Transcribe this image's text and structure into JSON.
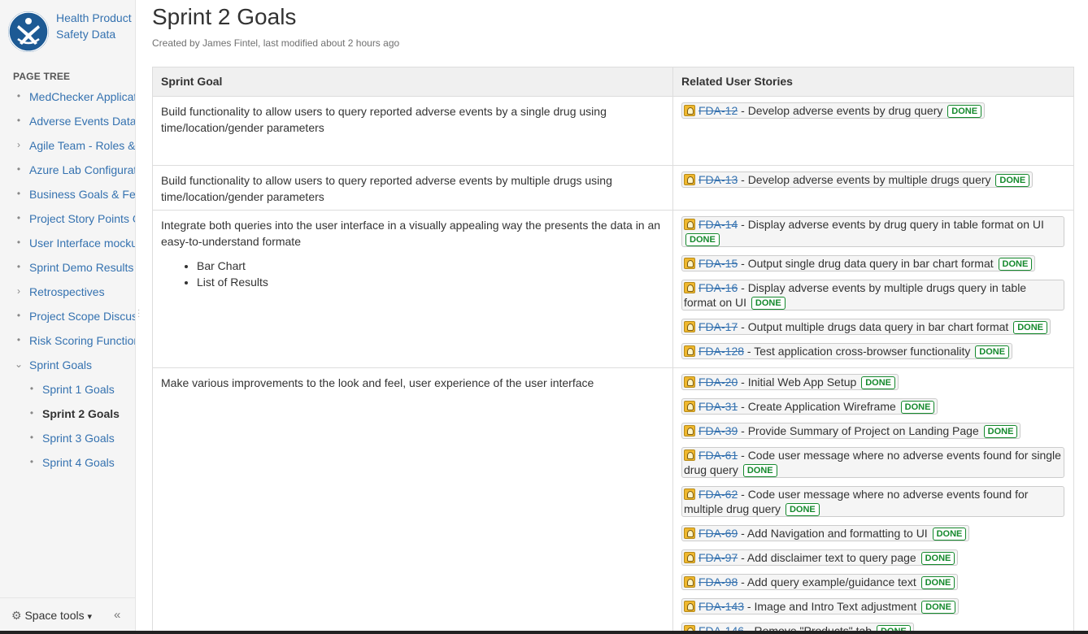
{
  "sidebar": {
    "space_name": "Health Product Safety Data",
    "page_tree_label": "PAGE TREE",
    "items": [
      {
        "label": "MedChecker Application",
        "marker": "•",
        "level": 0
      },
      {
        "label": "Adverse Events Data",
        "marker": "•",
        "level": 0
      },
      {
        "label": "Agile Team - Roles & Responsibilities",
        "marker": "›",
        "level": 0
      },
      {
        "label": "Azure Lab Configuration",
        "marker": "•",
        "level": 0
      },
      {
        "label": "Business Goals & Features",
        "marker": "•",
        "level": 0
      },
      {
        "label": "Project Story Points Overview",
        "marker": "•",
        "level": 0
      },
      {
        "label": "User Interface mockups",
        "marker": "•",
        "level": 0
      },
      {
        "label": "Sprint Demo Results",
        "marker": "•",
        "level": 0
      },
      {
        "label": "Retrospectives",
        "marker": "›",
        "level": 0
      },
      {
        "label": "Project Scope Discussion",
        "marker": "•",
        "level": 0
      },
      {
        "label": "Risk Scoring Function",
        "marker": "•",
        "level": 0
      },
      {
        "label": "Sprint Goals",
        "marker": "⌄",
        "level": 0
      },
      {
        "label": "Sprint 1 Goals",
        "marker": "•",
        "level": 1
      },
      {
        "label": "Sprint 2 Goals",
        "marker": "•",
        "level": 1,
        "current": true
      },
      {
        "label": "Sprint 3 Goals",
        "marker": "•",
        "level": 1
      },
      {
        "label": "Sprint 4 Goals",
        "marker": "•",
        "level": 1
      }
    ],
    "space_tools": "Space tools",
    "space_tools_caret": "▾",
    "collapse": "«"
  },
  "page": {
    "title": "Sprint 2 Goals",
    "byline": "Created by James Fintel, last modified about 2 hours ago"
  },
  "table": {
    "headers": [
      "Sprint Goal",
      "Related User Stories"
    ],
    "status_label": "DONE",
    "rows": [
      {
        "goal": "Build functionality to allow users to query reported adverse events by a single drug using time/location/gender parameters",
        "bullets": [],
        "stories": [
          {
            "key": "FDA-12",
            "summary": "Develop adverse events by drug query",
            "status": "DONE"
          }
        ]
      },
      {
        "goal": "Build functionality to allow users to query reported adverse events by multiple drugs using time/location/gender parameters",
        "bullets": [],
        "stories": [
          {
            "key": "FDA-13",
            "summary": "Develop adverse events by multiple drugs query",
            "status": "DONE"
          }
        ]
      },
      {
        "goal": "Integrate both queries into the user interface in a visually appealing way the presents the data in an easy-to-understand formate",
        "bullets": [
          "Bar Chart",
          "List of Results"
        ],
        "stories": [
          {
            "key": "FDA-14",
            "summary": "Display adverse events by drug query in table format on UI",
            "status": "DONE",
            "wide": true
          },
          {
            "key": "FDA-15",
            "summary": "Output single drug data query in bar chart format",
            "status": "DONE"
          },
          {
            "key": "FDA-16",
            "summary": "Display adverse events by multiple drugs query in table format on UI",
            "status": "DONE",
            "wide": true
          },
          {
            "key": "FDA-17",
            "summary": "Output multiple drugs data query in bar chart format",
            "status": "DONE"
          },
          {
            "key": "FDA-128",
            "summary": "Test application cross-browser functionality",
            "status": "DONE"
          }
        ]
      },
      {
        "goal": "Make various improvements to the look and feel, user experience of the user interface",
        "bullets": [],
        "stories": [
          {
            "key": "FDA-20",
            "summary": "Initial Web App Setup",
            "status": "DONE"
          },
          {
            "key": "FDA-31",
            "summary": "Create Application Wireframe",
            "status": "DONE"
          },
          {
            "key": "FDA-39",
            "summary": "Provide Summary of Project on Landing Page",
            "status": "DONE"
          },
          {
            "key": "FDA-61",
            "summary": "Code user message where no adverse events found for single drug query",
            "status": "DONE",
            "wide": true
          },
          {
            "key": "FDA-62",
            "summary": "Code user message where no adverse events found for multiple drug query",
            "status": "DONE",
            "wide": true
          },
          {
            "key": "FDA-69",
            "summary": "Add Navigation and formatting to UI",
            "status": "DONE"
          },
          {
            "key": "FDA-97",
            "summary": "Add disclaimer text to query page",
            "status": "DONE"
          },
          {
            "key": "FDA-98",
            "summary": "Add query example/guidance text",
            "status": "DONE"
          },
          {
            "key": "FDA-143",
            "summary": "Image and Intro Text adjustment",
            "status": "DONE"
          },
          {
            "key": "FDA-146",
            "summary": "Remove \"Products\" tab",
            "status": "DONE"
          }
        ]
      }
    ]
  }
}
